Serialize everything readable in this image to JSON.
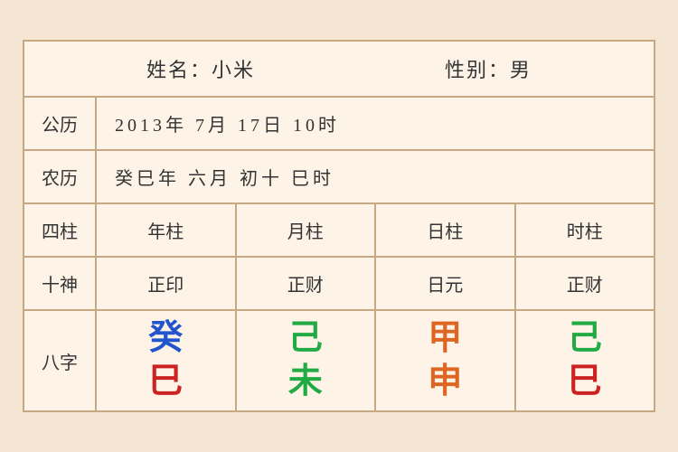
{
  "header": {
    "name_label": "姓名：小米",
    "gender_label": "性别：男"
  },
  "solar": {
    "label": "公历",
    "value": "2013年 7月 17日 10时"
  },
  "lunar": {
    "label": "农历",
    "value": "癸巳年 六月 初十 巳时"
  },
  "columns": {
    "label": "四柱",
    "items": [
      "年柱",
      "月柱",
      "日柱",
      "时柱"
    ]
  },
  "shishen": {
    "label": "十神",
    "items": [
      "正印",
      "正财",
      "日元",
      "正财"
    ]
  },
  "bazi": {
    "label": "八字",
    "items": [
      {
        "top": "癸",
        "bottom": "巳",
        "top_color": "blue",
        "bottom_color": "red"
      },
      {
        "top": "己",
        "bottom": "未",
        "top_color": "green",
        "bottom_color": "green"
      },
      {
        "top": "甲",
        "bottom": "申",
        "top_color": "orange",
        "bottom_color": "orange"
      },
      {
        "top": "己",
        "bottom": "巳",
        "top_color": "green2",
        "bottom_color": "red"
      }
    ]
  }
}
